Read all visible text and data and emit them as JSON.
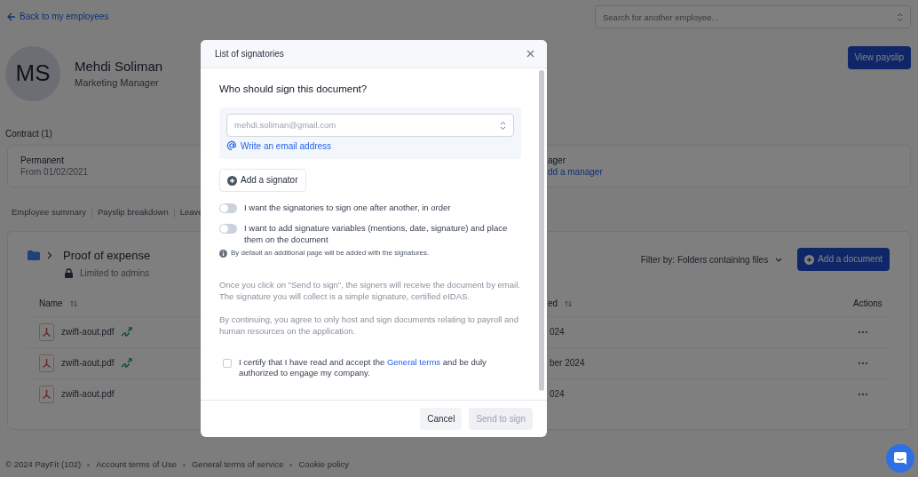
{
  "back_link": "Back to my employees",
  "employee_search": {
    "placeholder": "Search for another employee..."
  },
  "employee": {
    "initials": "MS",
    "name": "Mehdi Soliman",
    "job_title": "Marketing Manager"
  },
  "view_payslip_button": "View payslip",
  "contract_heading": "Contract (1)",
  "contract": {
    "type": "Permanent",
    "start": "From 01/02/2021",
    "column_2_label": "ager",
    "column_2_link": "dd a manager"
  },
  "tabs": [
    {
      "label": "Employee summary",
      "selected": false
    },
    {
      "label": "Payslip breakdown",
      "selected": false
    },
    {
      "label": "Leave",
      "selected": false
    }
  ],
  "folder": {
    "name": "Proof of expense",
    "access": "Limited to admins"
  },
  "filter": "Filter by: Folders containing files",
  "add_document_button": "Add a document",
  "table": {
    "columns": [
      "Name",
      "ed",
      "Actions"
    ],
    "rows": [
      {
        "name": "zwift-aout.pdf",
        "signed": true,
        "column_2": "024"
      },
      {
        "name": "zwift-aout.pdf",
        "signed": true,
        "column_2": "ber 2024"
      },
      {
        "name": "zwift-aout.pdf",
        "signed": false,
        "column_2": "024"
      }
    ]
  },
  "footer": [
    "© 2024 PayFit (102)",
    "Account terms of Use",
    "General terms of service",
    "Cookie policy"
  ],
  "modal": {
    "title": "List of signatories",
    "question": "Who should sign this document?",
    "email_field": {
      "placeholder": "mehdi.soliman@gmail.com"
    },
    "write_email_link": "Write an email address",
    "add_signator_button": "Add a signator",
    "options": [
      {
        "label": "I want the signatories to sign one after another, in order",
        "on": false
      },
      {
        "label": "I want to add signature variables (mentions, date, signature) and place them on the document",
        "on": false
      }
    ],
    "note": "By default an additional page will be added with the signatures.",
    "info": [
      "Once you click on \"Send to sign\", the signers will receive the document by email. The signature you will collect is a simple signature, certified eIDAS.",
      "By continuing, you agree to only host and sign documents relating to payroll and human resources on the application."
    ],
    "certify": {
      "before": "I certify that I have read and accept the",
      "link": "General terms",
      "after": "and be duly authorized to engage my company.",
      "checked": false
    },
    "buttons": [
      {
        "label": "Cancel",
        "disabled": false
      },
      {
        "label": "Send to sign",
        "disabled": true
      }
    ]
  }
}
